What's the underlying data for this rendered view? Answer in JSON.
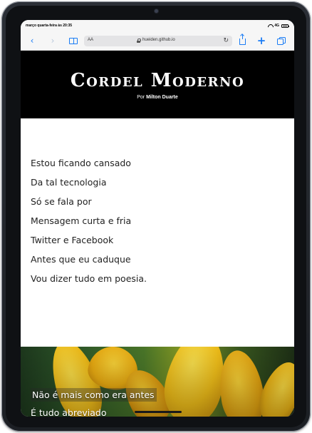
{
  "status_bar": {
    "time_date": "março quarta-feira às 20:35",
    "signal": "4G"
  },
  "browser": {
    "text_size_label": "AA",
    "url": "hueiden.github.io"
  },
  "page": {
    "title": "Cordel Moderno",
    "byline_prefix": "Por",
    "author": "Milton Duarte",
    "poem_lines": [
      "Estou ficando cansado",
      "Da tal tecnologia",
      "Só se fala por",
      "Mensagem curta e fria",
      "Twitter e Facebook",
      "Antes que eu caduque",
      "Vou dizer tudo em poesia."
    ],
    "hero_lines": [
      "Não é mais como era antes",
      "É tudo abreviado"
    ]
  },
  "icons": {
    "back": "chevron-left-icon",
    "forward": "chevron-right-icon",
    "bookmarks": "book-icon",
    "lock": "lock-icon",
    "reload": "reload-icon",
    "share": "share-icon",
    "new_tab": "plus-icon",
    "tabs": "tabs-icon",
    "wifi": "wifi-icon",
    "battery": "battery-icon"
  },
  "colors": {
    "accent": "#1a7cf5",
    "banner_bg": "#000000",
    "text": "#222222"
  }
}
